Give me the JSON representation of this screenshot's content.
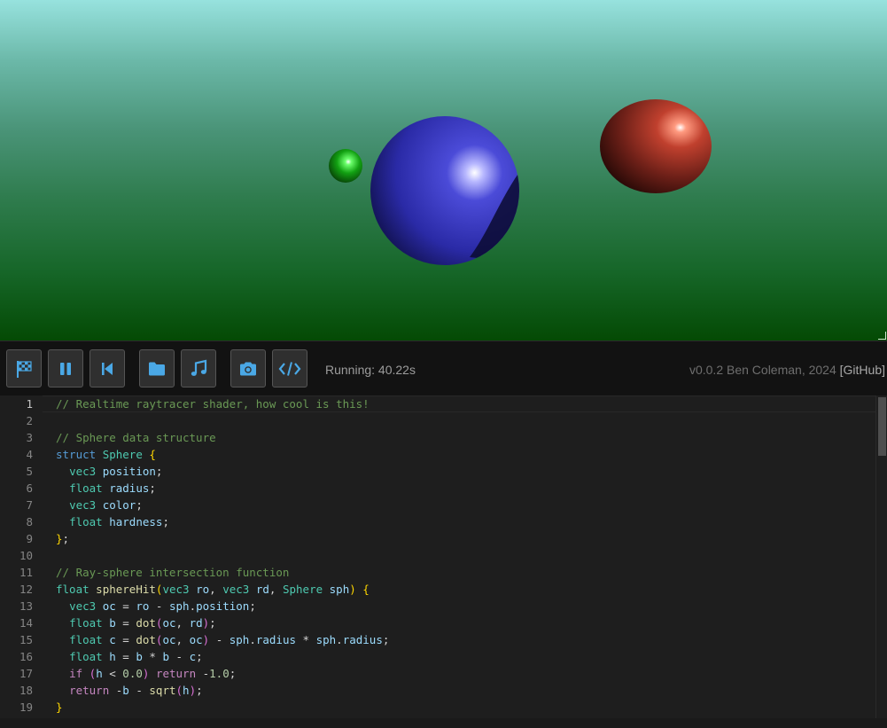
{
  "toolbar": {
    "buttons": [
      {
        "name": "fullscreen-button",
        "icon": "checkered-flag-icon"
      },
      {
        "name": "pause-button",
        "icon": "pause-icon"
      },
      {
        "name": "rewind-button",
        "icon": "skip-back-icon"
      },
      {
        "name": "open-file-button",
        "icon": "folder-icon"
      },
      {
        "name": "music-button",
        "icon": "music-note-icon"
      },
      {
        "name": "screenshot-button",
        "icon": "camera-icon"
      },
      {
        "name": "code-button",
        "icon": "code-icon"
      }
    ],
    "status": "Running: 40.22s",
    "credits_text": "v0.0.2 Ben Coleman, 2024",
    "github_link": "GitHub"
  },
  "editor": {
    "active_line": 1,
    "lines": [
      [
        [
          "c",
          "// Realtime raytracer shader, how cool is this!"
        ]
      ],
      [],
      [
        [
          "c",
          "// Sphere data structure"
        ]
      ],
      [
        [
          "k",
          "struct"
        ],
        [
          "o",
          " "
        ],
        [
          "t",
          "Sphere"
        ],
        [
          "o",
          " "
        ],
        [
          "p",
          "{"
        ]
      ],
      [
        [
          "o",
          "  "
        ],
        [
          "t",
          "vec3"
        ],
        [
          "o",
          " "
        ],
        [
          "v",
          "position"
        ],
        [
          "o",
          ";"
        ]
      ],
      [
        [
          "o",
          "  "
        ],
        [
          "t",
          "float"
        ],
        [
          "o",
          " "
        ],
        [
          "v",
          "radius"
        ],
        [
          "o",
          ";"
        ]
      ],
      [
        [
          "o",
          "  "
        ],
        [
          "t",
          "vec3"
        ],
        [
          "o",
          " "
        ],
        [
          "v",
          "color"
        ],
        [
          "o",
          ";"
        ]
      ],
      [
        [
          "o",
          "  "
        ],
        [
          "t",
          "float"
        ],
        [
          "o",
          " "
        ],
        [
          "v",
          "hardness"
        ],
        [
          "o",
          ";"
        ]
      ],
      [
        [
          "p",
          "}"
        ],
        [
          "o",
          ";"
        ]
      ],
      [],
      [
        [
          "c",
          "// Ray-sphere intersection function"
        ]
      ],
      [
        [
          "t",
          "float"
        ],
        [
          "o",
          " "
        ],
        [
          "f",
          "sphereHit"
        ],
        [
          "p",
          "("
        ],
        [
          "t",
          "vec3"
        ],
        [
          "o",
          " "
        ],
        [
          "v",
          "ro"
        ],
        [
          "o",
          ", "
        ],
        [
          "t",
          "vec3"
        ],
        [
          "o",
          " "
        ],
        [
          "v",
          "rd"
        ],
        [
          "o",
          ", "
        ],
        [
          "t",
          "Sphere"
        ],
        [
          "o",
          " "
        ],
        [
          "v",
          "sph"
        ],
        [
          "p",
          ")"
        ],
        [
          "o",
          " "
        ],
        [
          "p",
          "{"
        ]
      ],
      [
        [
          "o",
          "  "
        ],
        [
          "t",
          "vec3"
        ],
        [
          "o",
          " "
        ],
        [
          "v",
          "oc"
        ],
        [
          "o",
          " = "
        ],
        [
          "v",
          "ro"
        ],
        [
          "o",
          " - "
        ],
        [
          "v",
          "sph"
        ],
        [
          "o",
          "."
        ],
        [
          "v",
          "position"
        ],
        [
          "o",
          ";"
        ]
      ],
      [
        [
          "o",
          "  "
        ],
        [
          "t",
          "float"
        ],
        [
          "o",
          " "
        ],
        [
          "v",
          "b"
        ],
        [
          "o",
          " = "
        ],
        [
          "f",
          "dot"
        ],
        [
          "q",
          "("
        ],
        [
          "v",
          "oc"
        ],
        [
          "o",
          ", "
        ],
        [
          "v",
          "rd"
        ],
        [
          "q",
          ")"
        ],
        [
          "o",
          ";"
        ]
      ],
      [
        [
          "o",
          "  "
        ],
        [
          "t",
          "float"
        ],
        [
          "o",
          " "
        ],
        [
          "v",
          "c"
        ],
        [
          "o",
          " = "
        ],
        [
          "f",
          "dot"
        ],
        [
          "q",
          "("
        ],
        [
          "v",
          "oc"
        ],
        [
          "o",
          ", "
        ],
        [
          "v",
          "oc"
        ],
        [
          "q",
          ")"
        ],
        [
          "o",
          " - "
        ],
        [
          "v",
          "sph"
        ],
        [
          "o",
          "."
        ],
        [
          "v",
          "radius"
        ],
        [
          "o",
          " * "
        ],
        [
          "v",
          "sph"
        ],
        [
          "o",
          "."
        ],
        [
          "v",
          "radius"
        ],
        [
          "o",
          ";"
        ]
      ],
      [
        [
          "o",
          "  "
        ],
        [
          "t",
          "float"
        ],
        [
          "o",
          " "
        ],
        [
          "v",
          "h"
        ],
        [
          "o",
          " = "
        ],
        [
          "v",
          "b"
        ],
        [
          "o",
          " * "
        ],
        [
          "v",
          "b"
        ],
        [
          "o",
          " - "
        ],
        [
          "v",
          "c"
        ],
        [
          "o",
          ";"
        ]
      ],
      [
        [
          "o",
          "  "
        ],
        [
          "x",
          "if"
        ],
        [
          "o",
          " "
        ],
        [
          "q",
          "("
        ],
        [
          "v",
          "h"
        ],
        [
          "o",
          " < "
        ],
        [
          "n",
          "0.0"
        ],
        [
          "q",
          ")"
        ],
        [
          "o",
          " "
        ],
        [
          "x",
          "return"
        ],
        [
          "o",
          " -"
        ],
        [
          "n",
          "1.0"
        ],
        [
          "o",
          ";"
        ]
      ],
      [
        [
          "o",
          "  "
        ],
        [
          "x",
          "return"
        ],
        [
          "o",
          " -"
        ],
        [
          "v",
          "b"
        ],
        [
          "o",
          " - "
        ],
        [
          "f",
          "sqrt"
        ],
        [
          "q",
          "("
        ],
        [
          "v",
          "h"
        ],
        [
          "q",
          ")"
        ],
        [
          "o",
          ";"
        ]
      ],
      [
        [
          "p",
          "}"
        ]
      ]
    ]
  }
}
